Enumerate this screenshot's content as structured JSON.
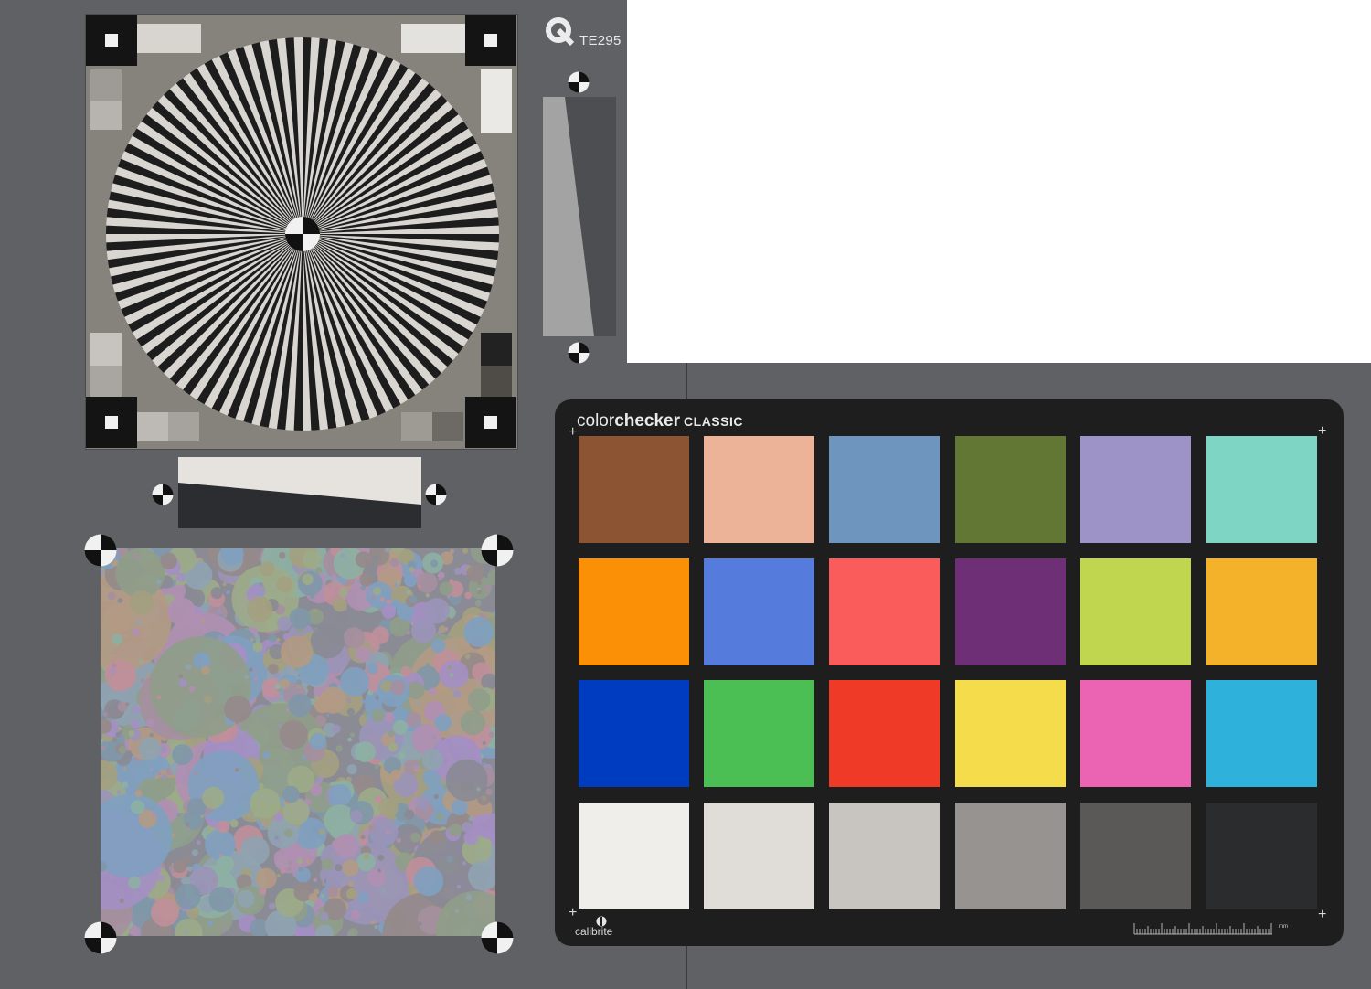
{
  "chart_label": "TE295",
  "colorchecker": {
    "title_light": "color",
    "title_bold": "checker",
    "title_classic": "CLASSIC",
    "brand": "calibrite",
    "ruler_unit": "mm",
    "patches": [
      "#8d5433",
      "#ecb399",
      "#6e95be",
      "#637734",
      "#9d93c7",
      "#7fd5c4",
      "#fb8f06",
      "#557bdc",
      "#fa5c5c",
      "#6e2f76",
      "#bfd64e",
      "#f4b12a",
      "#003cc0",
      "#4cbf54",
      "#f03a28",
      "#f5dc4a",
      "#ea64b3",
      "#2eb2dc",
      "#efeeea",
      "#e0ddd8",
      "#c8c4bf",
      "#979390",
      "#5a5957",
      "#2b2c2e"
    ]
  },
  "colors": {
    "board": "#606165",
    "checker_frame": "#1e1e1f",
    "siemens_background": "#86837d"
  }
}
